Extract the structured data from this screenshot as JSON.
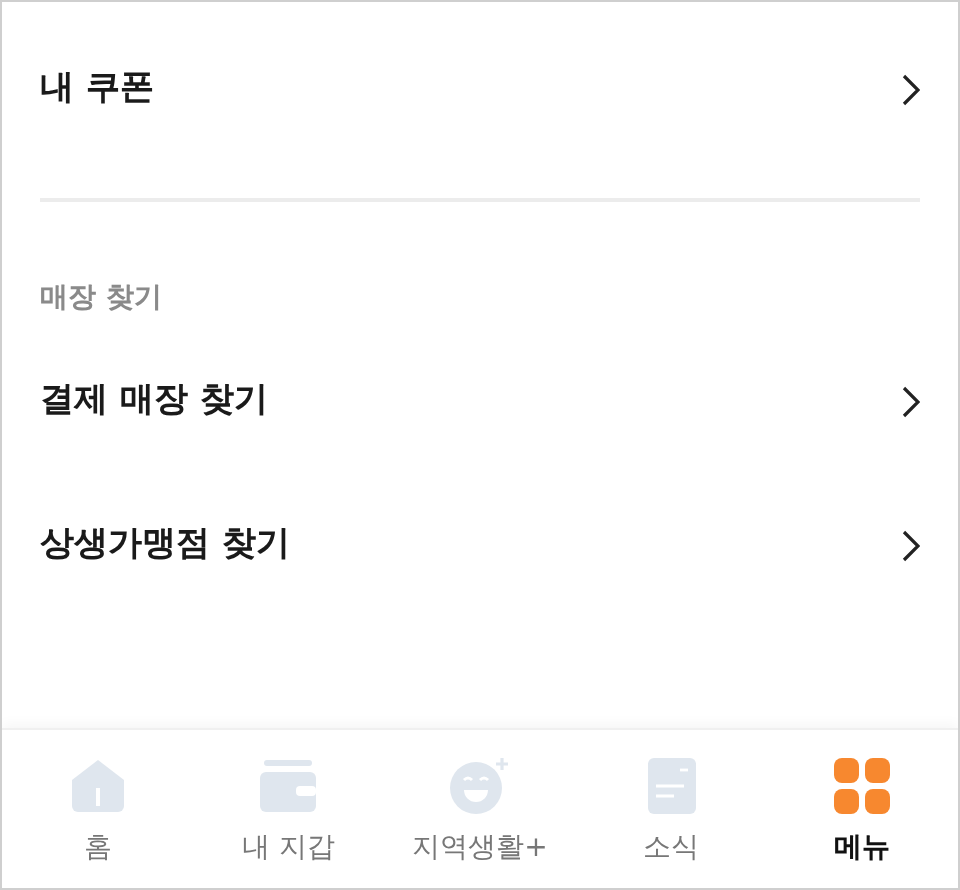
{
  "sections": [
    {
      "items": [
        {
          "label": "내 쿠폰"
        }
      ]
    },
    {
      "title": "매장 찾기",
      "items": [
        {
          "label": "결제 매장 찾기"
        },
        {
          "label": "상생가맹점 찾기"
        }
      ]
    }
  ],
  "nav": [
    {
      "kind": "home",
      "label": "홈",
      "selected": false
    },
    {
      "kind": "wallet",
      "label": "내 지갑",
      "selected": false
    },
    {
      "kind": "local",
      "label": "지역생활+",
      "selected": false
    },
    {
      "kind": "news",
      "label": "소식",
      "selected": false
    },
    {
      "kind": "menu",
      "label": "메뉴",
      "selected": true
    }
  ]
}
